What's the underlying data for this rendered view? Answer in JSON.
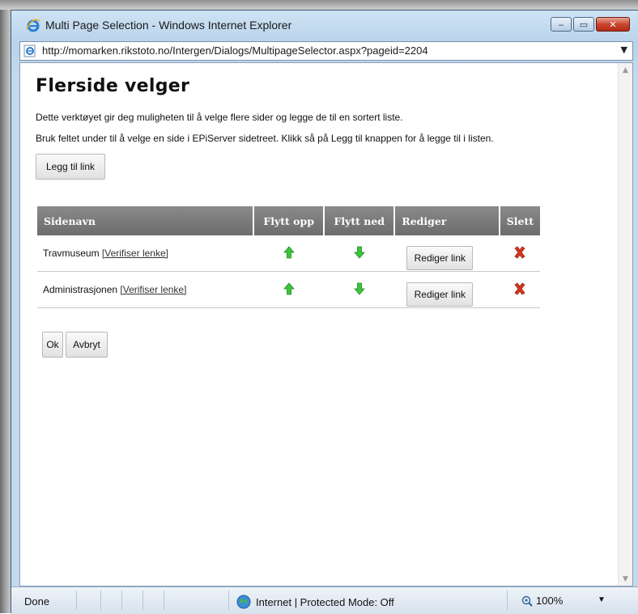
{
  "window": {
    "title": "Multi Page Selection - Windows Internet Explorer",
    "minimize": "‒",
    "maximize": "▭",
    "close": "✕"
  },
  "address": {
    "url": "http://momarken.rikstoto.no/Intergen/Dialogs/MultipageSelector.aspx?pageid=2204"
  },
  "page": {
    "title": "Flerside velger",
    "description1": "Dette verktøyet gir deg muligheten til å velge flere sider og legge de til en sortert liste.",
    "description2": "Bruk feltet under til å velge en side i EPiServer sidetreet. Klikk så på Legg til knappen for å legge til i listen.",
    "add_link_label": "Legg til link"
  },
  "table": {
    "headers": [
      "Sidenavn",
      "Flytt opp",
      "Flytt ned",
      "Rediger",
      "Slett"
    ],
    "rows": [
      {
        "name": "Travmuseum",
        "verify": "[Verifiser lenke]",
        "edit": "Rediger link"
      },
      {
        "name": "Administrasjonen",
        "verify": "[Verifiser lenke]",
        "edit": "Rediger link"
      }
    ]
  },
  "actions": {
    "ok": "Ok",
    "cancel": "Avbryt"
  },
  "status": {
    "left": "Done",
    "zone": "Internet | Protected Mode: Off",
    "zoom": "100%"
  },
  "colors": {
    "header_bg": "#7a7a7a",
    "arrow_green": "#3cc43c",
    "delete_red": "#d9361c"
  }
}
